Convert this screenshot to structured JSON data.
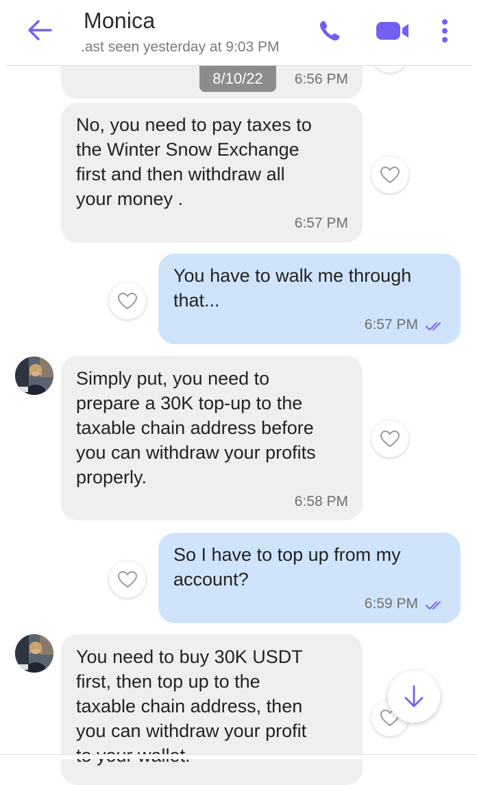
{
  "header": {
    "contact_name": "Monica",
    "last_seen": ".ast seen yesterday at 9:03 PM",
    "icons": [
      "back-arrow-icon",
      "phone-icon",
      "video-camera-icon",
      "more-vert-icon"
    ],
    "accent_color": "#7360f2"
  },
  "date_badge": "8/10/22",
  "messages": [
    {
      "direction": "incoming",
      "lines": [],
      "time": "6:56 PM"
    },
    {
      "direction": "incoming",
      "lines": [
        "No, you need to pay taxes to",
        "the Winter Snow Exchange",
        "first and then withdraw all",
        "your money ."
      ],
      "time": "6:57 PM"
    },
    {
      "direction": "outgoing",
      "lines": [
        "You have to walk me through",
        "that..."
      ],
      "time": "6:57 PM",
      "status": "read"
    },
    {
      "direction": "incoming",
      "lines": [
        "Simply put, you need to",
        "prepare a 30K top-up to the",
        "taxable chain address before",
        "you can withdraw your profits",
        "properly."
      ],
      "time": "6:58 PM"
    },
    {
      "direction": "outgoing",
      "lines": [
        "So I have to top up from my",
        "account?"
      ],
      "time": "6:59 PM",
      "status": "read"
    },
    {
      "direction": "incoming",
      "lines": [
        "You need to buy 30K USDT",
        "first, then top up to the",
        "taxable chain address, then",
        "you can withdraw your profit",
        "to your wallet."
      ],
      "time": ""
    }
  ],
  "colors": {
    "incoming_bubble": "#efefef",
    "outgoing_bubble": "#cfe4fb",
    "date_badge": "#8c8c8c"
  }
}
